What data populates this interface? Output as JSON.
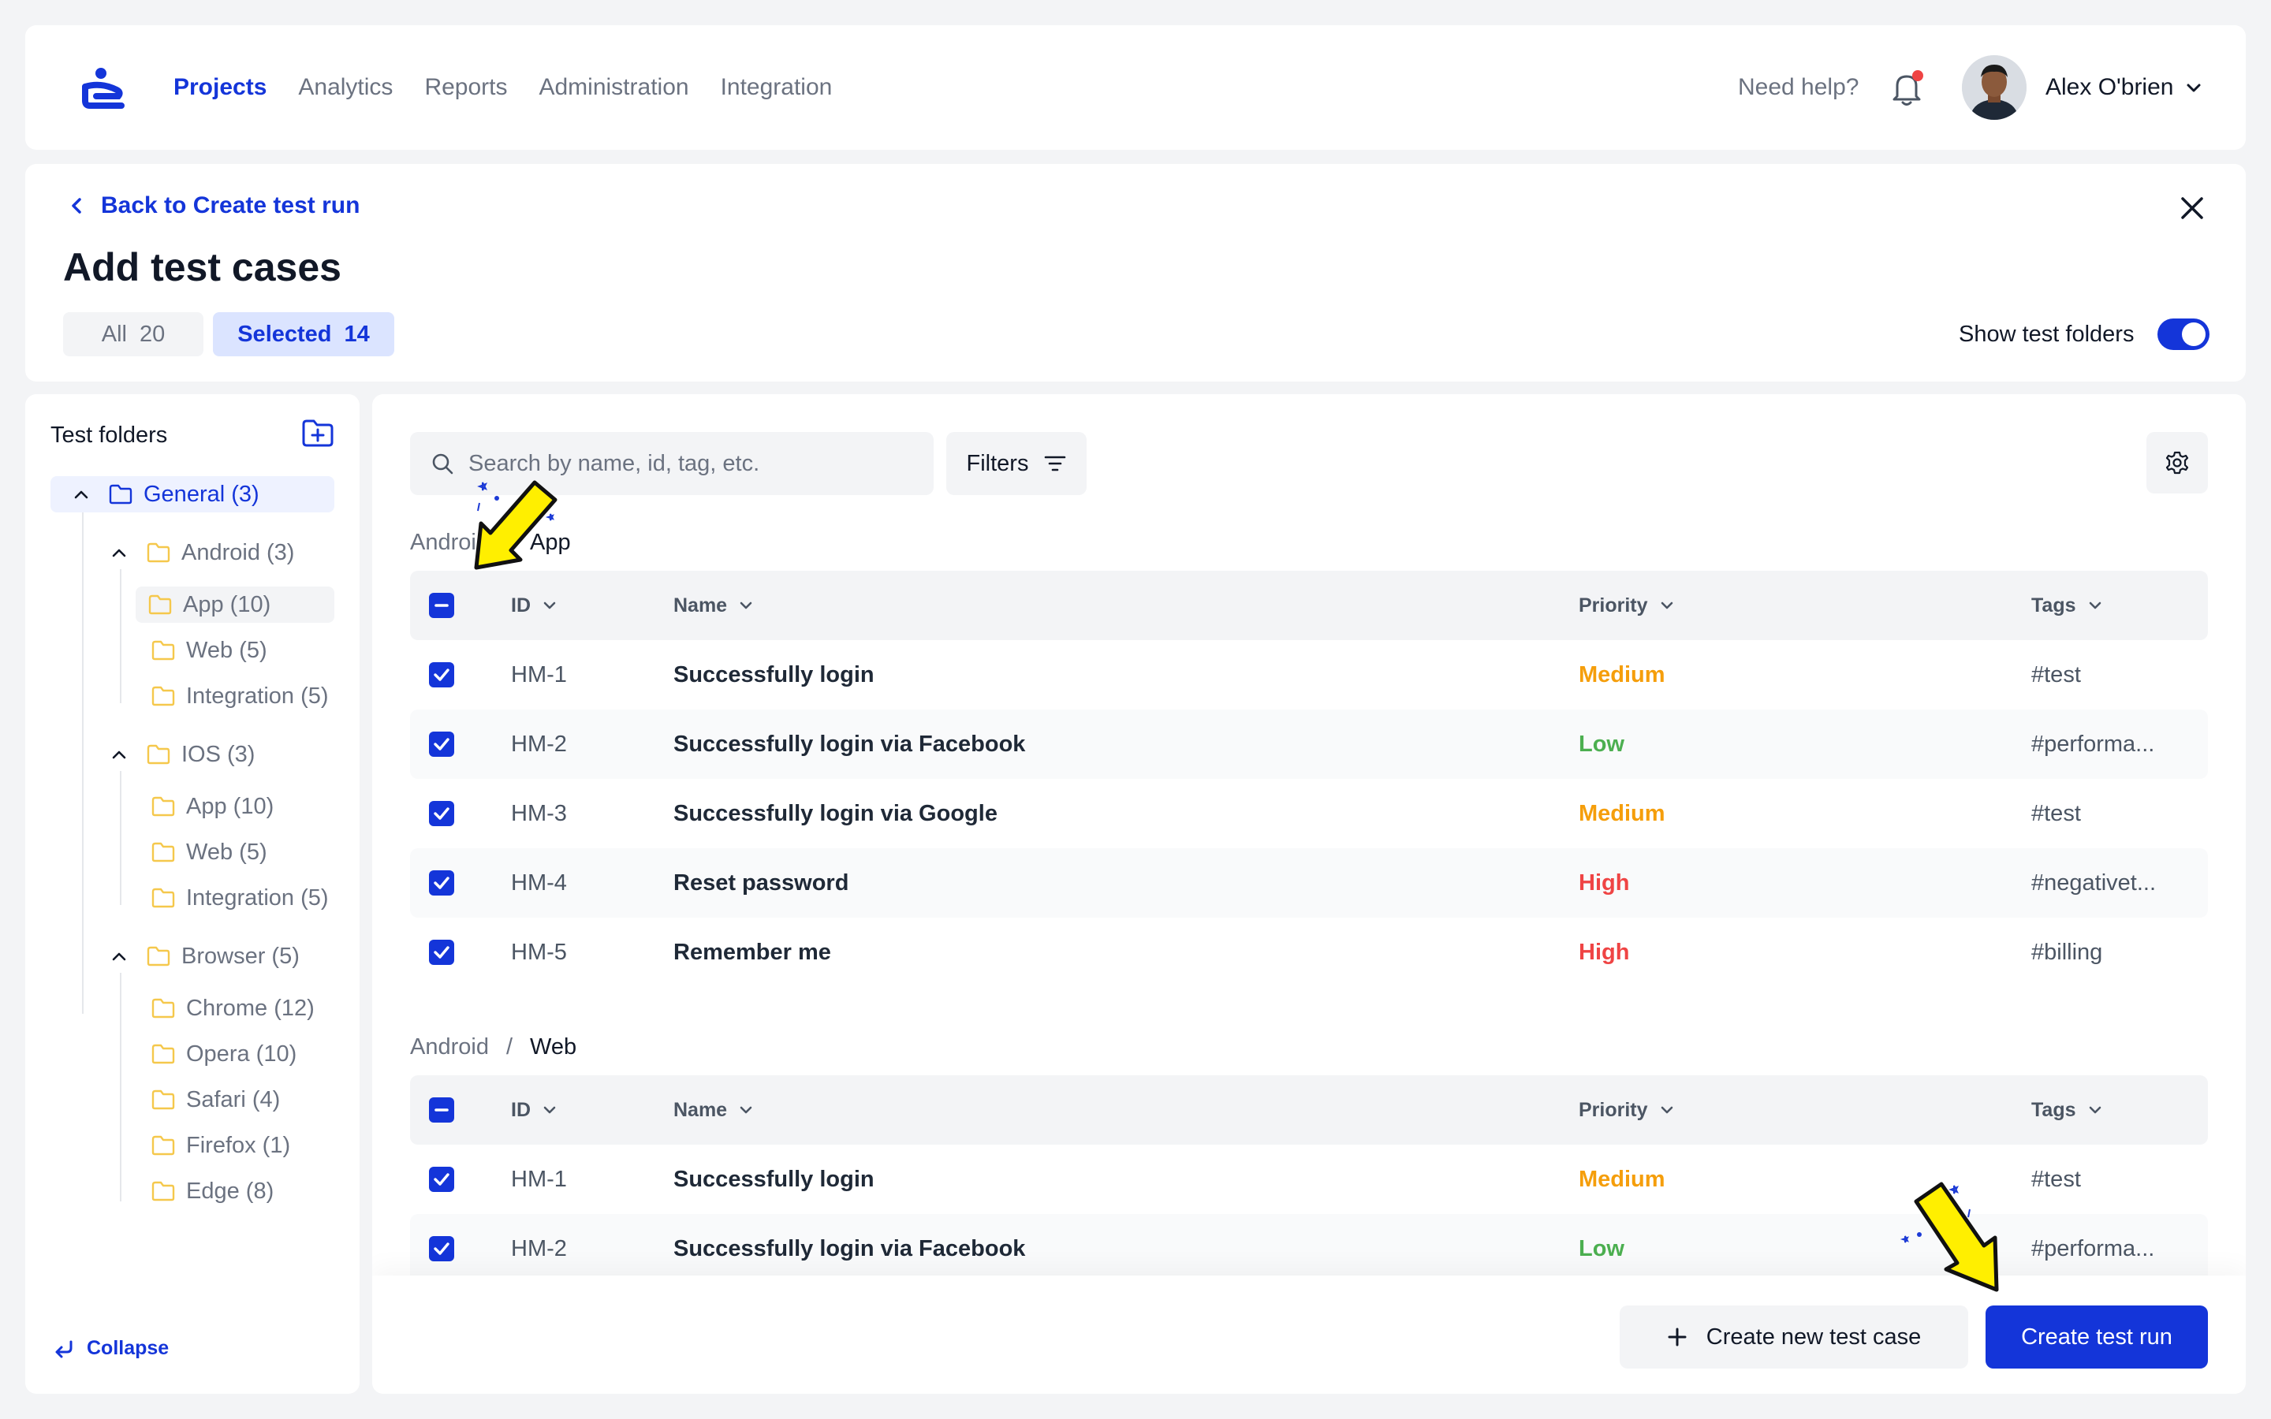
{
  "nav": {
    "links": [
      "Projects",
      "Analytics",
      "Reports",
      "Administration",
      "Integration"
    ],
    "help": "Need help?",
    "user": "Alex O'brien"
  },
  "header": {
    "back": "Back to Create test run",
    "title": "Add test cases",
    "all_label": "All",
    "all_count": "20",
    "selected_label": "Selected",
    "selected_count": "14",
    "show_folders": "Show test folders"
  },
  "sidebar": {
    "title": "Test folders",
    "general": "General (3)",
    "android": "Android (3)",
    "android_items": [
      "App (10)",
      "Web (5)",
      "Integration (5)"
    ],
    "ios": "IOS (3)",
    "ios_items": [
      "App (10)",
      "Web (5)",
      "Integration (5)"
    ],
    "browser": "Browser (5)",
    "browser_items": [
      "Chrome (12)",
      "Opera (10)",
      "Safari (4)",
      "Firefox (1)",
      "Edge (8)"
    ],
    "collapse": "Collapse"
  },
  "toolbar": {
    "search_placeholder": "Search by name, id, tag, etc.",
    "filters": "Filters"
  },
  "columns": {
    "id": "ID",
    "name": "Name",
    "priority": "Priority",
    "tags": "Tags"
  },
  "groups": [
    {
      "crumb_parent": "Android",
      "crumb_sep": "/",
      "crumb_current": "App",
      "rows": [
        {
          "id": "HM-1",
          "name": "Successfully login",
          "priority": "Medium",
          "tag": "#test"
        },
        {
          "id": "HM-2",
          "name": "Successfully login via Facebook",
          "priority": "Low",
          "tag": "#performa..."
        },
        {
          "id": "HM-3",
          "name": "Successfully login via Google",
          "priority": "Medium",
          "tag": "#test"
        },
        {
          "id": "HM-4",
          "name": "Reset password",
          "priority": "High",
          "tag": "#negativet..."
        },
        {
          "id": "HM-5",
          "name": "Remember me",
          "priority": "High",
          "tag": "#billing"
        }
      ]
    },
    {
      "crumb_parent": "Android",
      "crumb_sep": "/",
      "crumb_current": "Web",
      "rows": [
        {
          "id": "HM-1",
          "name": "Successfully login",
          "priority": "Medium",
          "tag": "#test"
        },
        {
          "id": "HM-2",
          "name": "Successfully login via Facebook",
          "priority": "Low",
          "tag": "#performa..."
        }
      ]
    }
  ],
  "footer": {
    "create_case": "Create new test case",
    "create_run": "Create test run"
  },
  "colors": {
    "accent": "#1435d9",
    "medium": "#f59e0b",
    "low": "#4caf50",
    "high": "#ef4444",
    "folder": "#f5c84c"
  }
}
